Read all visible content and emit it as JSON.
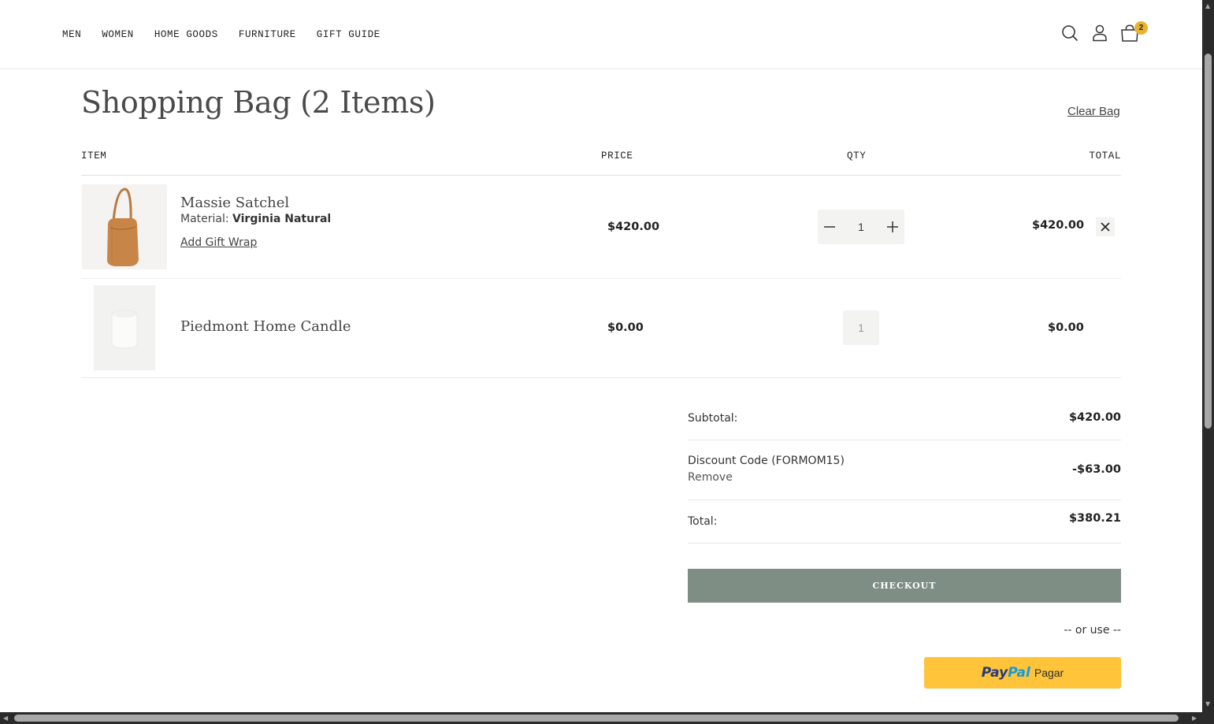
{
  "nav": {
    "items": [
      "MEN",
      "WOMEN",
      "HOME GOODS",
      "FURNITURE",
      "GIFT GUIDE"
    ]
  },
  "header": {
    "cart_count": "2",
    "icons": [
      "search-icon",
      "account-icon",
      "shopping-bag-icon"
    ]
  },
  "page": {
    "title": "Shopping Bag (2 Items)",
    "clear_bag": "Clear Bag"
  },
  "table": {
    "headers": {
      "item": "ITEM",
      "price": "PRICE",
      "qty": "QTY",
      "total": "TOTAL"
    },
    "rows": [
      {
        "name": "Massie Satchel",
        "attr_label": "Material:",
        "attr_value": "Virginia Natural",
        "gift_wrap": "Add Gift Wrap",
        "price": "$420.00",
        "qty": "1",
        "total": "$420.00"
      },
      {
        "name": "Piedmont Home Candle",
        "price": "$0.00",
        "qty": "1",
        "total": "$0.00"
      }
    ]
  },
  "summary": {
    "subtotal_label": "Subtotal:",
    "subtotal_value": "$420.00",
    "discount_label": "Discount Code (FORMOM15)",
    "discount_remove": "Remove",
    "discount_value": "-$63.00",
    "total_label": "Total:",
    "total_value": "$380.21"
  },
  "checkout": {
    "button_label": "CHECKOUT",
    "or_use": "-- or use --",
    "paypal_pay": "Pay",
    "paypal_pal": "Pal",
    "paypal_label": "Pagar"
  },
  "colors": {
    "checkout_bg": "#7f8e85",
    "badge": "#e8b32e",
    "paypal_bg": "#ffc439"
  }
}
